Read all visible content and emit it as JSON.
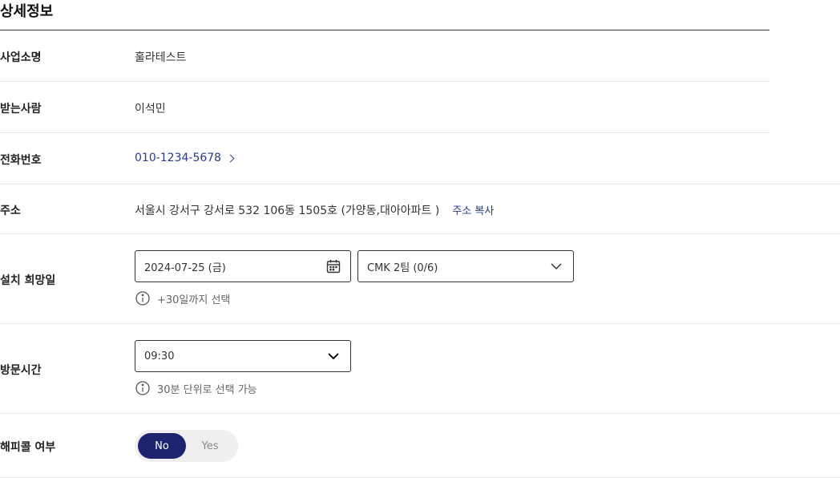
{
  "section_title": "상세정보",
  "fields": {
    "business_name": {
      "label": "사업소명",
      "value": "훌라테스트"
    },
    "recipient": {
      "label": "받는사람",
      "value": "이석민"
    },
    "phone": {
      "label": "전화번호",
      "value": "010-1234-5678"
    },
    "address": {
      "label": "주소",
      "value": "서울시 강서구 강서로 532 106동 1505호 (가양동,대아아파트 )",
      "copy_label": "주소 복사"
    },
    "install_date": {
      "label": "설치 희망일",
      "date_value": "2024-07-25 (금)",
      "team_value": "CMK 2팀 (0/6)",
      "hint": "+30일까지 선택"
    },
    "visit_time": {
      "label": "방문시간",
      "value": "09:30",
      "hint": "30분 단위로 선택 가능"
    },
    "happy_call": {
      "label": "해피콜 여부",
      "options": [
        "No",
        "Yes"
      ],
      "selected": "No"
    }
  },
  "icons": {
    "phone_link": "chevron-right-icon",
    "date": "calendar-icon",
    "team_dropdown": "chevron-down-icon",
    "time_dropdown": "chevron-down-icon",
    "hint": "info-icon"
  },
  "colors": {
    "link": "#2b3a8f",
    "toggle_active": "#1c2470",
    "toggle_track": "#efefef"
  }
}
